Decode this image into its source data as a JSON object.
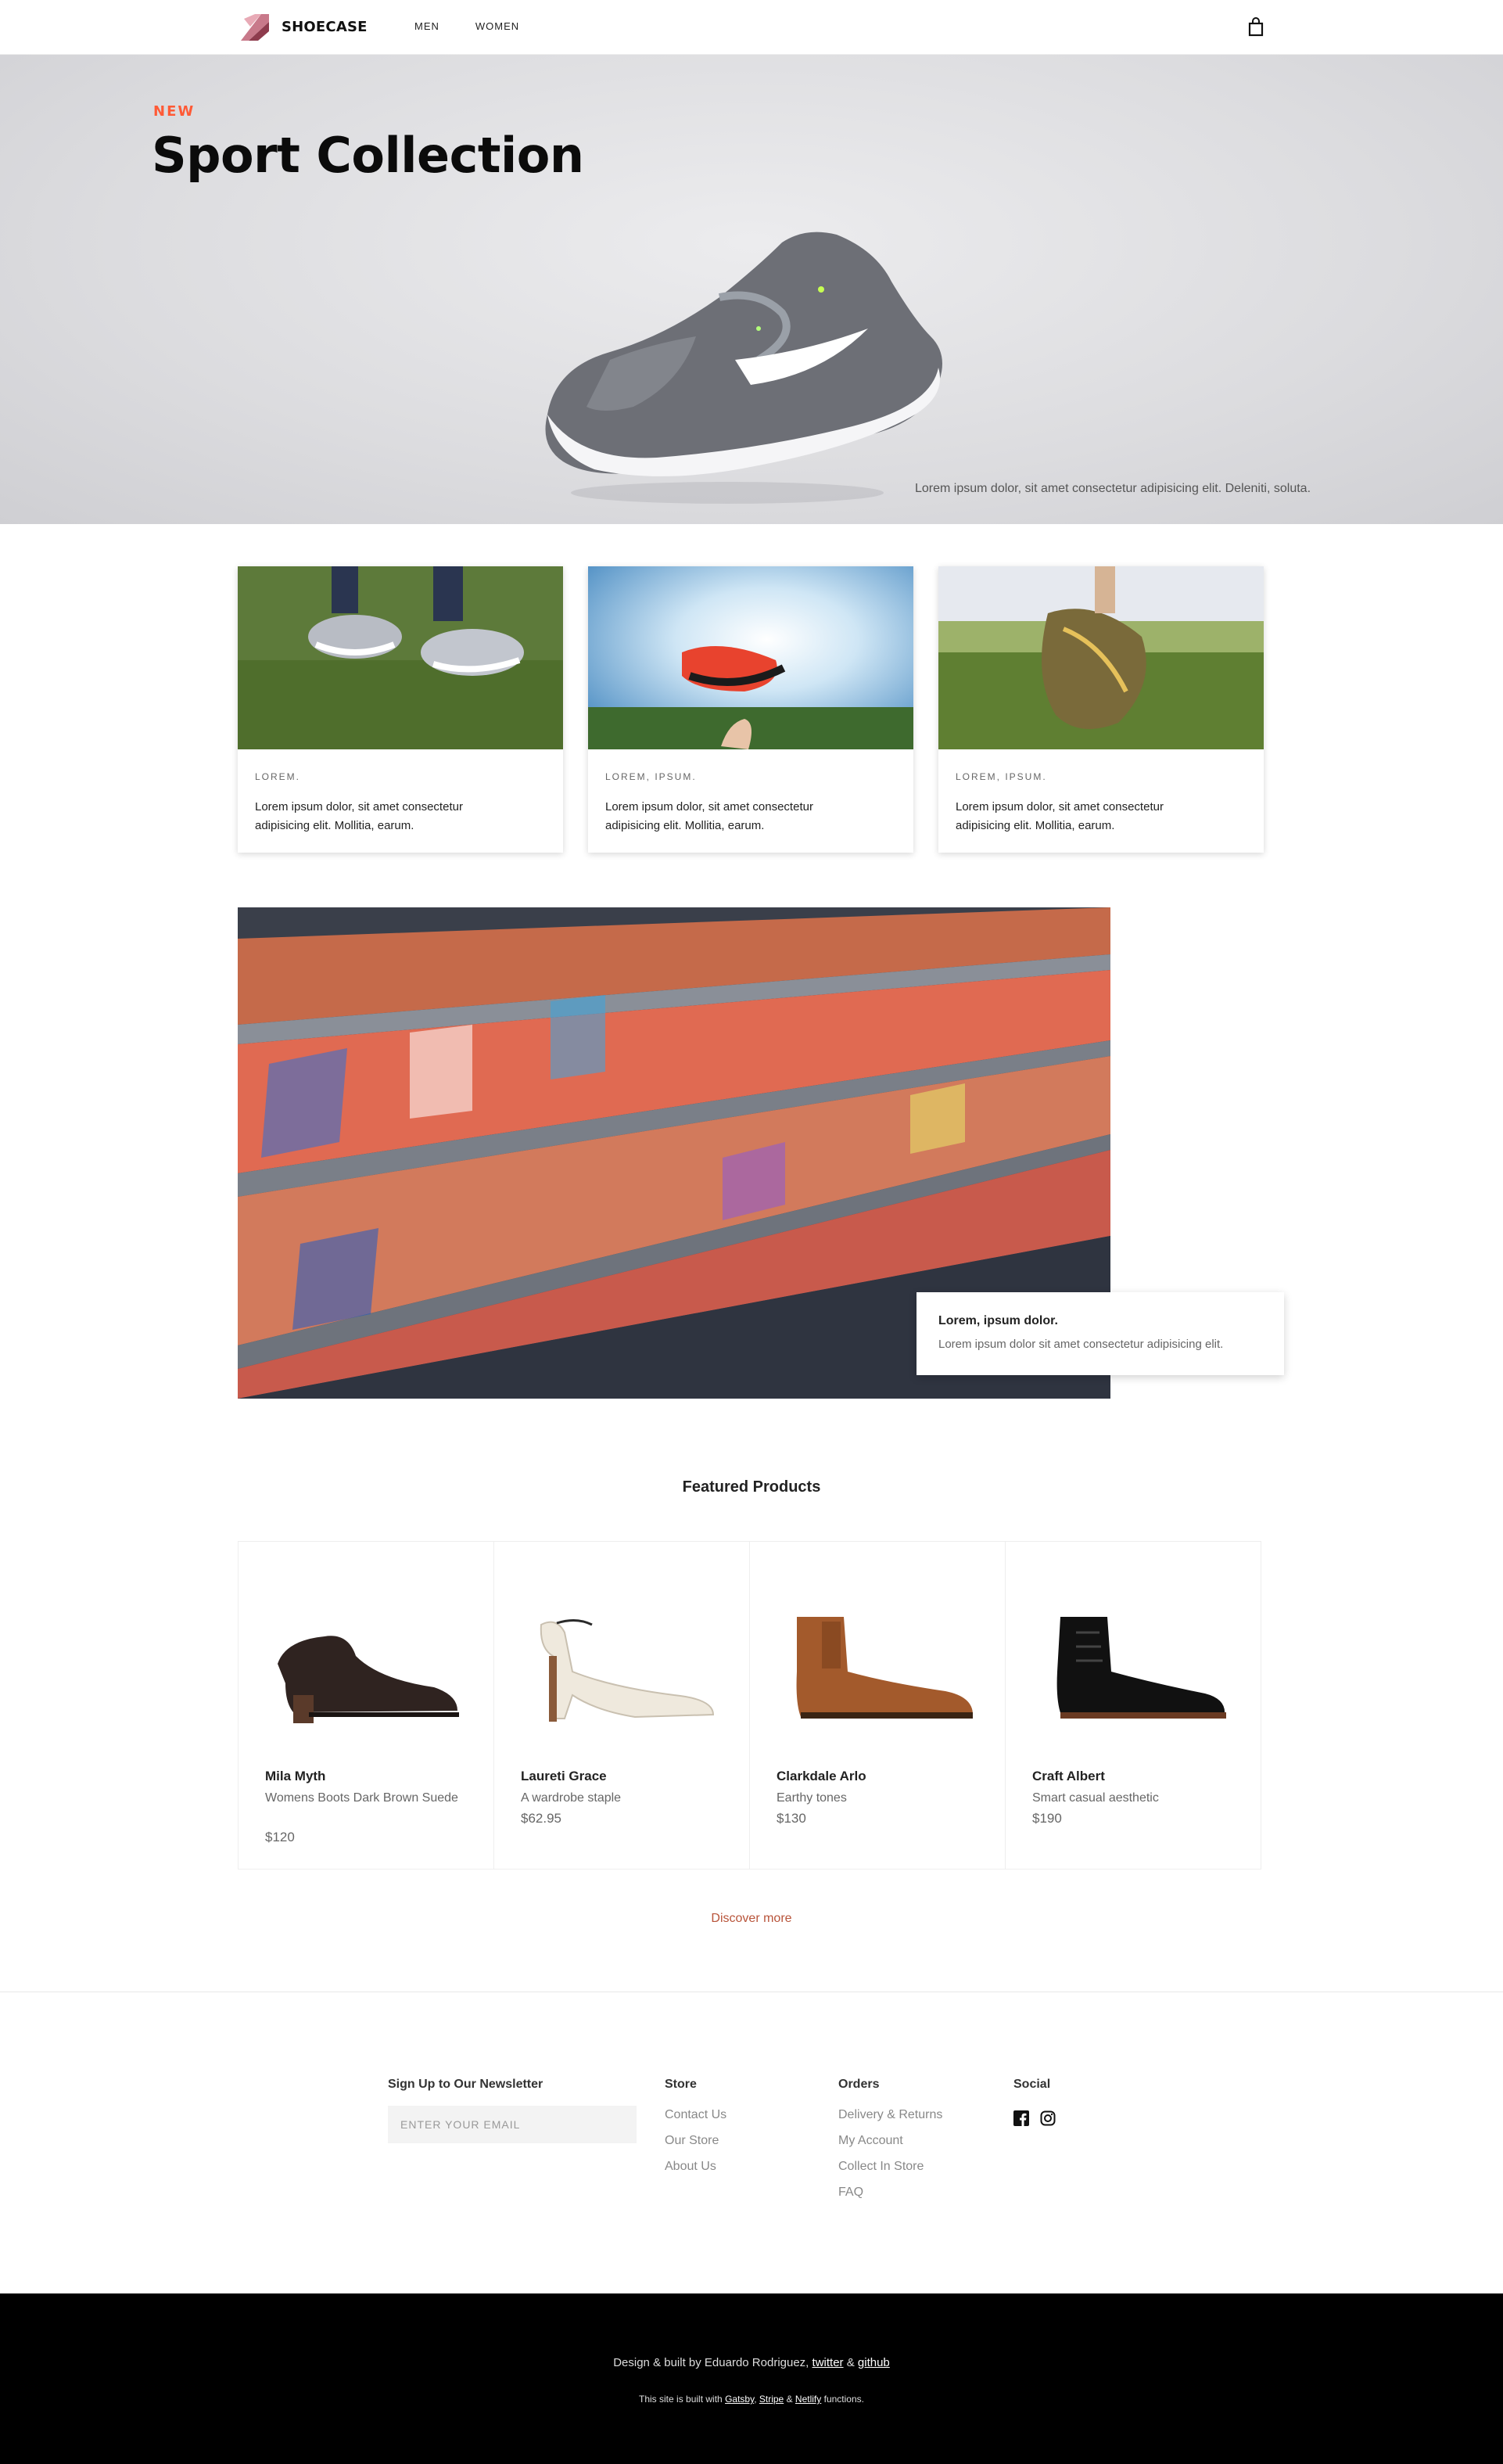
{
  "header": {
    "brand": "SHOECASE",
    "nav": [
      "MEN",
      "WOMEN"
    ]
  },
  "hero": {
    "eyebrow": "NEW",
    "title": "Sport Collection",
    "description": "Lorem ipsum dolor, sit amet consectetur adipisicing elit. Deleniti, soluta."
  },
  "cards": [
    {
      "tag": "LOREM.",
      "text": "Lorem ipsum dolor, sit amet consectetur adipisicing elit. Mollitia, earum."
    },
    {
      "tag": "LOREM, IPSUM.",
      "text": "Lorem ipsum dolor, sit amet consectetur adipisicing elit. Mollitia, earum."
    },
    {
      "tag": "LOREM, IPSUM.",
      "text": "Lorem ipsum dolor, sit amet consectetur adipisicing elit. Mollitia, earum."
    }
  ],
  "feature": {
    "heading": "Lorem, ipsum dolor.",
    "text": "Lorem ipsum dolor sit amet consectetur adipisicing elit."
  },
  "featured": {
    "title": "Featured Products",
    "products": [
      {
        "name": "Mila Myth",
        "desc": "Womens Boots Dark Brown Suede",
        "price": "$120"
      },
      {
        "name": "Laureti Grace",
        "desc": "A wardrobe staple",
        "price": "$62.95"
      },
      {
        "name": "Clarkdale Arlo",
        "desc": "Earthy tones",
        "price": "$130"
      },
      {
        "name": "Craft Albert",
        "desc": "Smart casual aesthetic",
        "price": "$190"
      }
    ],
    "discover": "Discover more"
  },
  "footer": {
    "newsletter_title": "Sign Up to Our Newsletter",
    "email_placeholder": "ENTER YOUR EMAIL",
    "store_title": "Store",
    "store_links": [
      "Contact Us",
      "Our Store",
      "About Us"
    ],
    "orders_title": "Orders",
    "orders_links": [
      "Delivery & Returns",
      "My Account",
      "Collect In Store",
      "FAQ"
    ],
    "social_title": "Social",
    "credit_prefix": "Design & built by Eduardo Rodriguez,",
    "twitter": "twitter",
    "amp": "&",
    "github": "github",
    "built_prefix": "This site is built with",
    "gatsby": "Gatsby",
    "stripe": "Stripe",
    "netlify": "Netlify",
    "built_suffix": "functions."
  },
  "colors": {
    "accent": "#ff5a36",
    "discover": "#b8543a",
    "footer_bg": "#000000"
  }
}
